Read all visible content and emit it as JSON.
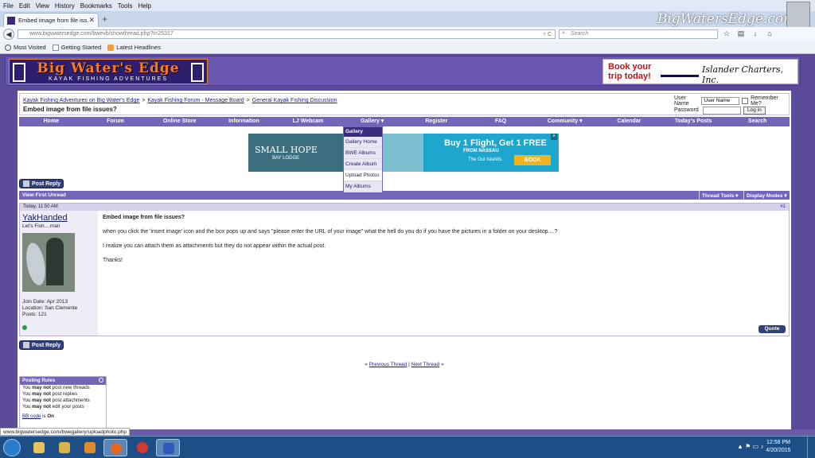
{
  "browser": {
    "menu": [
      "File",
      "Edit",
      "View",
      "History",
      "Bookmarks",
      "Tools",
      "Help"
    ],
    "tab_title": "Embed image from file iss...",
    "url": "www.bigwatersedge.com/bwevb/showthread.php?t=25317",
    "search_placeholder": "Search",
    "bookmarks": [
      "Most Visited",
      "Getting Started",
      "Latest Headlines"
    ],
    "status_url": "www.bigwatersedge.com/bwegallery/uploadphoto.php"
  },
  "watermark": "BigWatersEdge.com",
  "site": {
    "logo_title": "Big Water's Edge",
    "logo_subtitle": "KAYAK FISHING ADVENTURES",
    "ad_top": {
      "line1": "Book your",
      "line2": "trip today!",
      "brand": "Islander Charters, Inc."
    }
  },
  "breadcrumb": {
    "items": [
      "Kayak Fishing Adventures on Big Water's Edge",
      "Kayak Fishing Forum - Message Board",
      "General Kayak Fishing Discussion"
    ],
    "sep": ">",
    "current": "Embed image from file issues?"
  },
  "login": {
    "username_label": "User Name",
    "username_value": "User Name",
    "password_label": "Password",
    "remember_label": "Remember Me?",
    "login_button": "Log in"
  },
  "nav": [
    "Home",
    "Forum",
    "Online Store",
    "Information",
    "LJ Webcam",
    "Gallery ▾",
    "Register",
    "FAQ",
    "Community ▾",
    "Calendar",
    "Today's Posts",
    "Search"
  ],
  "gallery_menu": {
    "header": "Gallery",
    "items": [
      "Gallery Home",
      "BWE Albums",
      "Create Album",
      "Upload Photos",
      "My Albums"
    ]
  },
  "banner_ad": {
    "brand": "SMALL HOPE",
    "brand_sub": "BAY LODGE",
    "headline": "Buy 1 Flight, Get 1 FREE",
    "sub": "FROM NASSAU",
    "cta": "BOOK",
    "partner": "The Out Islands",
    "close": "×"
  },
  "post_reply_label": "Post Reply",
  "thread_bar": {
    "view_first_unread": "View First Unread",
    "thread_tools": "Thread Tools ▾",
    "display_modes": "Display Modes ▾"
  },
  "post": {
    "timestamp": "Today, 11:50 AM",
    "number": "#1",
    "username": "YakHanded",
    "user_title": "Let's Fish....man",
    "join_date": "Join Date: Apr 2013",
    "location": "Location: San Clemente",
    "posts": "Posts: 121",
    "title": "Embed image from file issues?",
    "body": [
      "when you click the 'insert image' icon and the box pops up and says \"please enter the URL of your image\" what the hell do you do if you have the pictures in a folder on your desktop....?",
      "I realize you can attach them as attachments but they do not appear within the actual post.",
      "Thanks!"
    ],
    "quote_label": "Quote"
  },
  "thread_nav": {
    "prev": "Previous Thread",
    "next": "Next Thread",
    "left": "«",
    "sep": "|",
    "right": "»"
  },
  "posting_rules": {
    "title": "Posting Rules",
    "lines": [
      {
        "pre": "You ",
        "bold": "may not",
        "post": " post new threads"
      },
      {
        "pre": "You ",
        "bold": "may not",
        "post": " post replies"
      },
      {
        "pre": "You ",
        "bold": "may not",
        "post": " post attachments"
      },
      {
        "pre": "You ",
        "bold": "may not",
        "post": " edit your posts"
      }
    ],
    "bbcode_link": "BB code",
    "bbcode_is": " is ",
    "bbcode_state": "On"
  },
  "taskbar": {
    "time": "12:58 PM",
    "date": "4/20/2015"
  }
}
